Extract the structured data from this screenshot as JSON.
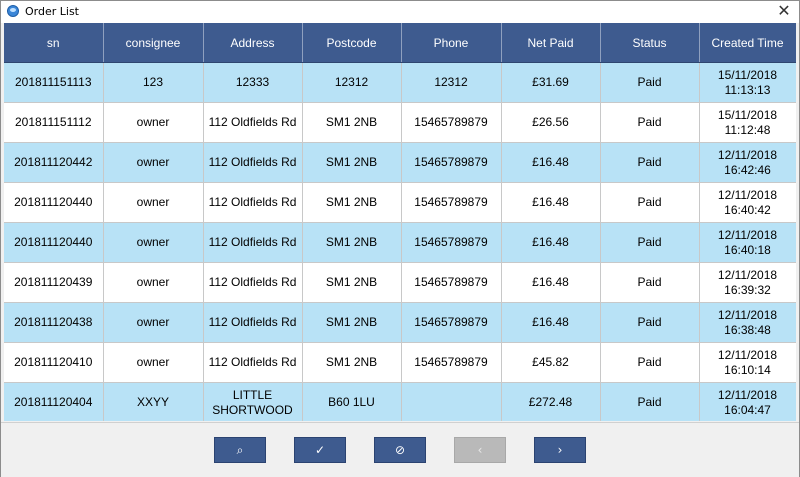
{
  "window": {
    "title": "Order List",
    "close_glyph": "✕"
  },
  "table": {
    "headers": [
      "sn",
      "consignee",
      "Address",
      "Postcode",
      "Phone",
      "Net Paid",
      "Status",
      "Created Time"
    ],
    "rows": [
      [
        "201811151113",
        "123",
        "12333",
        "12312",
        "12312",
        "£31.69",
        "Paid",
        "15/11/2018\n11:13:13"
      ],
      [
        "201811151112",
        "owner",
        "112 Oldfields Rd",
        "SM1 2NB",
        "15465789879",
        "£26.56",
        "Paid",
        "15/11/2018\n11:12:48"
      ],
      [
        "201811120442",
        "owner",
        "112 Oldfields Rd",
        "SM1 2NB",
        "15465789879",
        "£16.48",
        "Paid",
        "12/11/2018\n16:42:46"
      ],
      [
        "201811120440",
        "owner",
        "112 Oldfields Rd",
        "SM1 2NB",
        "15465789879",
        "£16.48",
        "Paid",
        "12/11/2018\n16:40:42"
      ],
      [
        "201811120440",
        "owner",
        "112 Oldfields Rd",
        "SM1 2NB",
        "15465789879",
        "£16.48",
        "Paid",
        "12/11/2018\n16:40:18"
      ],
      [
        "201811120439",
        "owner",
        "112 Oldfields Rd",
        "SM1 2NB",
        "15465789879",
        "£16.48",
        "Paid",
        "12/11/2018\n16:39:32"
      ],
      [
        "201811120438",
        "owner",
        "112 Oldfields Rd",
        "SM1 2NB",
        "15465789879",
        "£16.48",
        "Paid",
        "12/11/2018\n16:38:48"
      ],
      [
        "201811120410",
        "owner",
        "112 Oldfields Rd",
        "SM1 2NB",
        "15465789879",
        "£45.82",
        "Paid",
        "12/11/2018\n16:10:14"
      ],
      [
        "201811120404",
        "XXYY",
        "LITTLE\nSHORTWOOD",
        "B60 1LU",
        "",
        "£272.48",
        "Paid",
        "12/11/2018\n16:04:47"
      ]
    ]
  },
  "footer": {
    "buttons": [
      {
        "name": "search-button",
        "icon": "search-icon",
        "glyph": "⌕",
        "enabled": true
      },
      {
        "name": "confirm-button",
        "icon": "check-icon",
        "glyph": "✓",
        "enabled": true
      },
      {
        "name": "verify-button",
        "icon": "check-circle-icon",
        "glyph": "⊘",
        "enabled": true
      },
      {
        "name": "previous-page-button",
        "icon": "chevron-left-icon",
        "glyph": "‹",
        "enabled": false
      },
      {
        "name": "next-page-button",
        "icon": "chevron-right-icon",
        "glyph": "›",
        "enabled": true
      }
    ]
  },
  "colors": {
    "header_bg": "#3e5b8f",
    "row_highlight": "#b8e2f6",
    "row_plain": "#ffffff",
    "button_bg": "#3e5b8f",
    "button_disabled": "#b9b9b9"
  }
}
